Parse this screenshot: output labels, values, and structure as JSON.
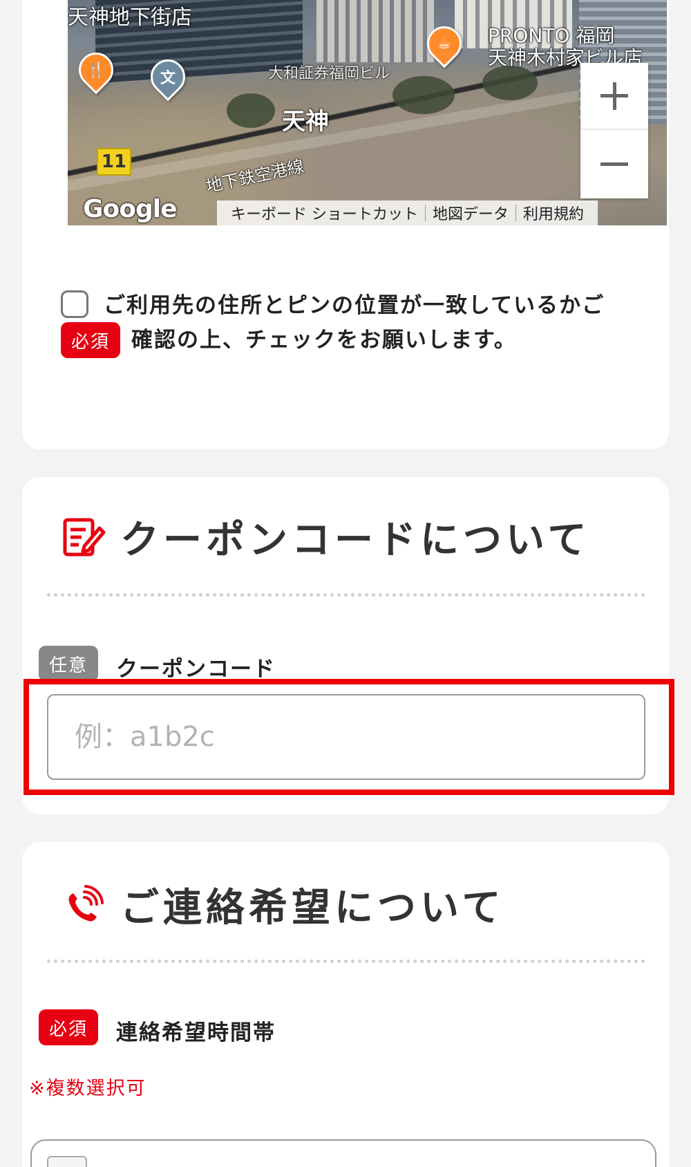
{
  "map": {
    "labels": {
      "store": "天神地下街店",
      "cafe_name_line1": "PRONTO 福岡",
      "cafe_name_line2": "天神木村家ビル店",
      "building": "大和証券福岡ビル",
      "station": "天神",
      "subway_line": "地下鉄空港線",
      "route_sign": "11",
      "google_logo": "Google"
    },
    "pins": {
      "restaurant_glyph": "🍴",
      "school_glyph": "文",
      "cafe_glyph": "☕"
    },
    "footer": {
      "shortcuts": "キーボード ショートカット",
      "map_data": "地図データ",
      "terms": "利用規約"
    },
    "zoom": {
      "in_label": "+",
      "out_label": "−"
    }
  },
  "confirm": {
    "badge": "必須",
    "text_line1": "ご利用先の住所とピンの位置が一致しているかご",
    "text_line2": "確認の上、チェックをお願いします。",
    "checked": false
  },
  "coupon_section": {
    "title": "クーポンコードについて",
    "icon": "edit-document-icon",
    "badge": "任意",
    "field_label": "クーポンコード",
    "input_value": "",
    "input_placeholder": "例：a1b2c"
  },
  "contact_section": {
    "title": "ご連絡希望について",
    "icon": "phone-ringing-icon",
    "badge": "必須",
    "field_label": "連絡希望時間帯",
    "note": "※複数選択可"
  },
  "colors": {
    "required_red": "#e60012",
    "optional_gray": "#888888",
    "highlight_red": "#ee0000",
    "background": "#f3f3f3"
  }
}
